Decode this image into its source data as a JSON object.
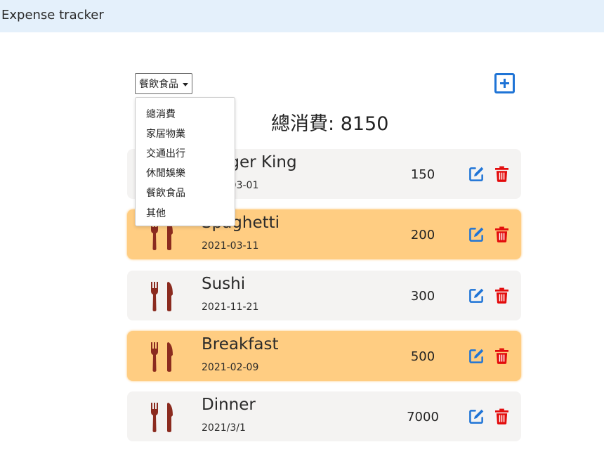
{
  "app": {
    "title": "Expense tracker"
  },
  "filter": {
    "selected": "餐飲食品",
    "options": [
      "總消費",
      "家居物業",
      "交通出行",
      "休閒娛樂",
      "餐飲食品",
      "其他"
    ]
  },
  "total": {
    "label": "總消費",
    "separator": ": ",
    "amount": "8150"
  },
  "expenses": [
    {
      "name": "Burger King",
      "date": "2021-03-01",
      "amount": "150",
      "highlighted": false,
      "icon": "utensils-icon"
    },
    {
      "name": "Spaghetti",
      "date": "2021-03-11",
      "amount": "200",
      "highlighted": true,
      "icon": "utensils-icon"
    },
    {
      "name": "Sushi",
      "date": "2021-11-21",
      "amount": "300",
      "highlighted": false,
      "icon": "utensils-icon"
    },
    {
      "name": "Breakfast",
      "date": "2021-02-09",
      "amount": "500",
      "highlighted": true,
      "icon": "utensils-icon"
    },
    {
      "name": "Dinner",
      "date": "2021/3/1",
      "amount": "7000",
      "highlighted": false,
      "icon": "utensils-icon"
    }
  ],
  "colors": {
    "navbar": "#e4f0fb",
    "card_gray": "#f4f3f2",
    "card_highlight": "#ffcd82",
    "category_icon": "#8b2b1f",
    "edit_icon": "#1f74d6",
    "delete_icon": "#e30b0b",
    "add_button": "#1f74d6"
  }
}
